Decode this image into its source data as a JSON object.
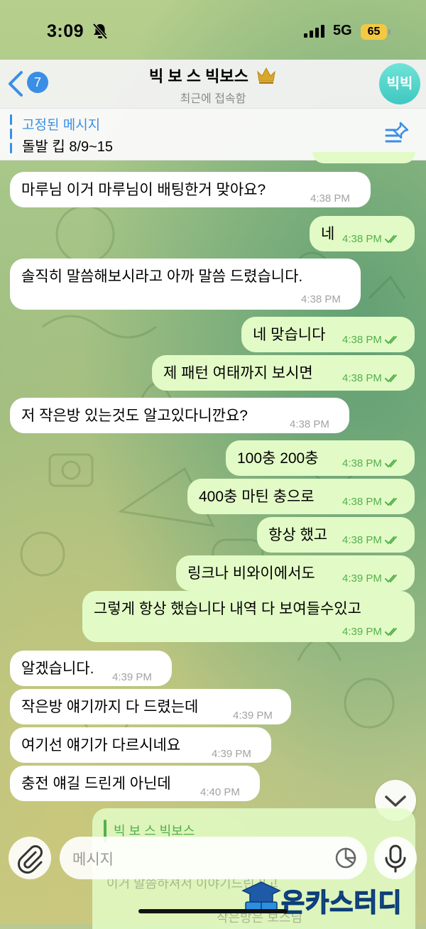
{
  "status_bar": {
    "time": "3:09",
    "network": "5G",
    "battery": "65"
  },
  "header": {
    "back_count": "7",
    "title": "빅 보 스 빅보스",
    "subtitle": "최근에 접속함",
    "avatar_text": "빅빅"
  },
  "pinned": {
    "title": "고정된 메시지",
    "text": "돌발 킵 8/9~15"
  },
  "messages": [
    {
      "dir": "in",
      "text": "마루님 이거 마루님이 배팅한거 맞아요?",
      "time": "4:38 PM"
    },
    {
      "dir": "out",
      "text": "네",
      "time": "4:38 PM"
    },
    {
      "dir": "in",
      "text": "솔직히 말씀해보시라고 아까 말씀 드렸습니다.",
      "time": "4:38 PM"
    },
    {
      "dir": "out",
      "text": "네 맞습니다",
      "time": "4:38 PM"
    },
    {
      "dir": "out",
      "text": "제 패턴 여태까지 보시면",
      "time": "4:38 PM"
    },
    {
      "dir": "in",
      "text": "저 작은방 있는것도 알고있다니깐요?",
      "time": "4:38 PM"
    },
    {
      "dir": "out",
      "text": "100충 200충",
      "time": "4:38 PM"
    },
    {
      "dir": "out",
      "text": "400충 마틴 충으로",
      "time": "4:38 PM"
    },
    {
      "dir": "out",
      "text": "항상 했고",
      "time": "4:38 PM"
    },
    {
      "dir": "out",
      "text": "링크나 비와이에서도",
      "time": "4:39 PM"
    },
    {
      "dir": "out",
      "text": "그렇게 항상 했습니다 내역 다 보여들수있고",
      "time": "4:39 PM"
    },
    {
      "dir": "in",
      "text": "알겠습니다.",
      "time": "4:39 PM"
    },
    {
      "dir": "in",
      "text": "작은방 얘기까지 다 드렸는데",
      "time": "4:39 PM"
    },
    {
      "dir": "in",
      "text": "여기선 얘기가 다르시네요",
      "time": "4:39 PM"
    },
    {
      "dir": "in",
      "text": "충전 얘길 드린게 아닌데",
      "time": "4:40 PM"
    }
  ],
  "reply_preview": {
    "name": "빅 보 스 빅보스",
    "text": "이거 말씀하셔서 이야기드린거고",
    "text2": "작은방은 보스님"
  },
  "input": {
    "placeholder": "메시지"
  },
  "watermark": {
    "text": "온카스터디"
  },
  "colors": {
    "accent": "#3a8ee6",
    "outgoing_bubble": "#e2fbc6",
    "incoming_bubble": "#ffffff",
    "outgoing_meta": "#54b04c",
    "avatar": "#4fd0c8"
  }
}
